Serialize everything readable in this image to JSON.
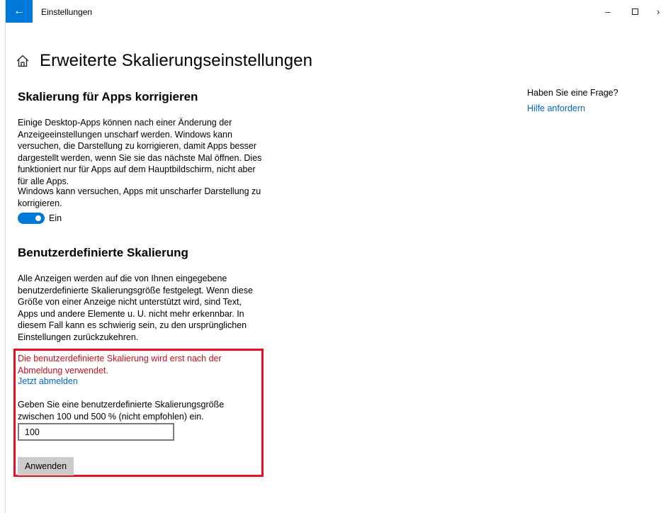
{
  "window": {
    "title": "Einstellungen",
    "back_icon": "←",
    "minimize_icon": "–",
    "close_icon": "›"
  },
  "page": {
    "title": "Erweiterte Skalierungseinstellungen"
  },
  "fix_apps": {
    "heading": "Skalierung für Apps korrigieren",
    "description": "Einige Desktop-Apps können nach einer Änderung der Anzeigeeinstellungen unscharf werden. Windows kann versuchen, die Darstellung zu korrigieren, damit Apps besser dargestellt werden, wenn Sie sie das nächste Mal öffnen. Dies funktioniert nur für Apps auf dem Hauptbildschirm, nicht aber für alle Apps.",
    "toggle_caption": "Windows kann versuchen, Apps mit unscharfer Darstellung zu korrigieren.",
    "toggle_state": "Ein",
    "toggle_on": true
  },
  "custom_scaling": {
    "heading": "Benutzerdefinierte Skalierung",
    "description": "Alle Anzeigen werden auf die von Ihnen eingegebene benutzerdefinierte Skalierungsgröße festgelegt. Wenn diese Größe von einer Anzeige nicht unterstützt wird, sind Text, Apps und andere Elemente u. U. nicht mehr erkennbar. In diesem Fall kann es schwierig sein, zu den ursprünglichen Einstellungen zurückzukehren.",
    "warning": "Die benutzerdefinierte Skalierung wird erst nach der Abmeldung verwendet.",
    "logout_link": "Jetzt abmelden",
    "input_prompt": "Geben Sie eine benutzerdefinierte Skalierungsgröße zwischen 100 und 500 % (nicht empfohlen) ein.",
    "input_value": "100",
    "apply_label": "Anwenden"
  },
  "help": {
    "question": "Haben Sie eine Frage?",
    "link": "Hilfe anfordern"
  },
  "colors": {
    "accent": "#0078d7",
    "warning": "#c50f1f",
    "highlight_border": "#e81123",
    "link": "#0067c0"
  }
}
